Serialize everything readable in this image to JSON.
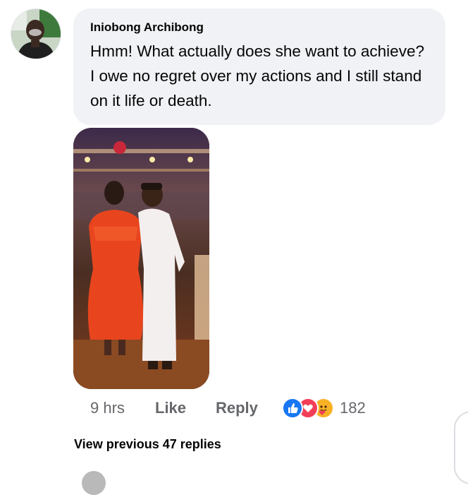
{
  "comment": {
    "author": "Iniobong Archibong",
    "text": "Hmm! What actually does she want to achieve? I owe no regret over my actions and I still stand on it life or death.",
    "photo_icon": "photo-attachment-icon"
  },
  "actions": {
    "timestamp": "9 hrs",
    "like_label": "Like",
    "reply_label": "Reply",
    "reaction_count": "182",
    "reaction_icons": [
      "like-icon",
      "love-icon",
      "care-icon"
    ],
    "colors": {
      "like": "#1877f2",
      "love": "#f33e58",
      "care": "#f7b125",
      "muted_text": "#65676b"
    }
  },
  "replies": {
    "view_previous_label": "View previous 47 replies"
  },
  "colors": {
    "bubble_bg": "#f0f2f5",
    "text": "#050505"
  }
}
